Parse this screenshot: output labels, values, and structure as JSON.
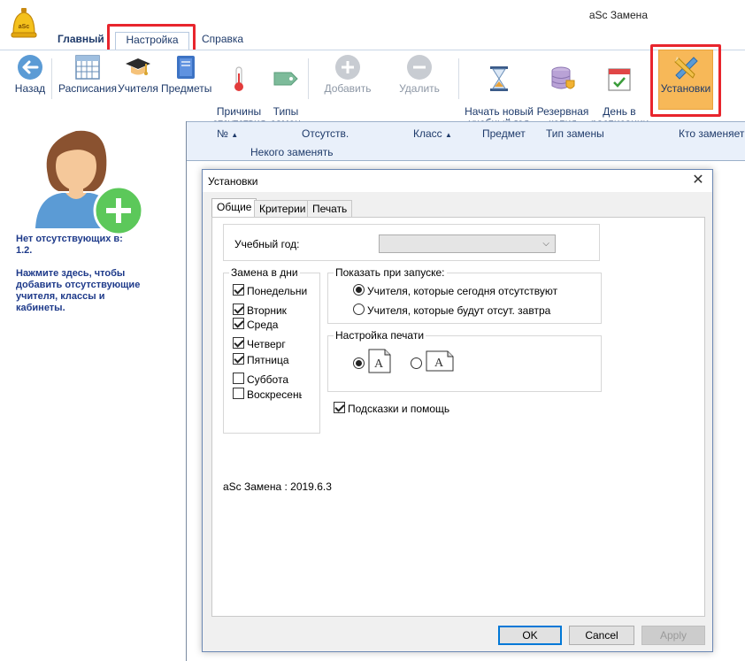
{
  "app": {
    "title": "aSc Замена"
  },
  "menu": {
    "tabs": [
      {
        "label": "Главный"
      },
      {
        "label": "Настройка"
      },
      {
        "label": "Справка"
      }
    ]
  },
  "toolbar": {
    "buttons": [
      {
        "label": "Назад",
        "icon": "back-arrow-icon"
      },
      {
        "label": "Расписания",
        "icon": "calendar-icon"
      },
      {
        "label": "Учителя",
        "icon": "graduation-cap-icon"
      },
      {
        "label": "Предметы",
        "icon": "book-icon"
      },
      {
        "label": "Причины\nотсутствия",
        "icon": "thermometer-icon"
      },
      {
        "label": "Типы\nзамен",
        "icon": "tag-icon"
      },
      {
        "label": "Добавить",
        "icon": "plus-circle-icon",
        "disabled": true
      },
      {
        "label": "Удалить",
        "icon": "minus-circle-icon",
        "disabled": true
      },
      {
        "label": "Начать новый\nучебный год",
        "icon": "hourglass-icon"
      },
      {
        "label": "Резервная\nкопия",
        "icon": "database-shield-icon"
      },
      {
        "label": "День в\nрасписании",
        "icon": "calendar-check-icon"
      },
      {
        "label": "Установки",
        "icon": "pencil-ruler-icon",
        "active": true
      }
    ]
  },
  "left_panel": {
    "no_absent_line1": "Нет отсутствующих в:",
    "no_absent_line2": "1.2.",
    "hint_line1": "Нажмите здесь, чтобы",
    "hint_line2": "добавить отсутствующие",
    "hint_line3": "учителя, классы и",
    "hint_line4": "кабинеты."
  },
  "grid": {
    "columns": [
      {
        "label": "№",
        "sort": "asc"
      },
      {
        "label": "Отсутств."
      },
      {
        "label": "Класс",
        "sort": "asc"
      },
      {
        "label": "Предмет"
      },
      {
        "label": "Тип замены"
      },
      {
        "label": "Кто заменяет"
      }
    ],
    "subheader": "Некого заменять"
  },
  "dialog": {
    "title": "Установки",
    "close_glyph": "✕",
    "tabs": [
      {
        "label": "Общие",
        "active": true
      },
      {
        "label": "Критерии"
      },
      {
        "label": "Печать"
      }
    ],
    "school_year_label": "Учебный год:",
    "school_year_value": "",
    "days_group_title": "Замена в дни",
    "days": [
      {
        "label": "Понедельни",
        "checked": true
      },
      {
        "label": "Вторник",
        "checked": true
      },
      {
        "label": "Среда",
        "checked": true
      },
      {
        "label": "Четверг",
        "checked": true
      },
      {
        "label": "Пятница",
        "checked": true
      },
      {
        "label": "Суббота",
        "checked": false
      },
      {
        "label": "Воскресенье",
        "checked": false
      }
    ],
    "startup_group_title": "Показать при запуске:",
    "startup_options": [
      {
        "label": "Учителя, которые сегодня отсутствуют",
        "checked": true
      },
      {
        "label": "Учителя, которые будут отсут. завтра",
        "checked": false
      }
    ],
    "print_group_title": "Настройка печати",
    "print_options": [
      {
        "orientation": "portrait",
        "checked": true,
        "glyph": "A"
      },
      {
        "orientation": "landscape",
        "checked": false,
        "glyph": "A"
      }
    ],
    "hints_label": "Подсказки и помощь",
    "hints_checked": true,
    "version": "aSc Замена : 2019.6.3",
    "buttons": {
      "ok": "OK",
      "cancel": "Cancel",
      "apply": "Apply"
    }
  },
  "colors": {
    "accent_orange": "#f7b858",
    "highlight_red": "#e8252d",
    "nav_blue": "#1e3a6a",
    "green_plus": "#5cc85a"
  }
}
